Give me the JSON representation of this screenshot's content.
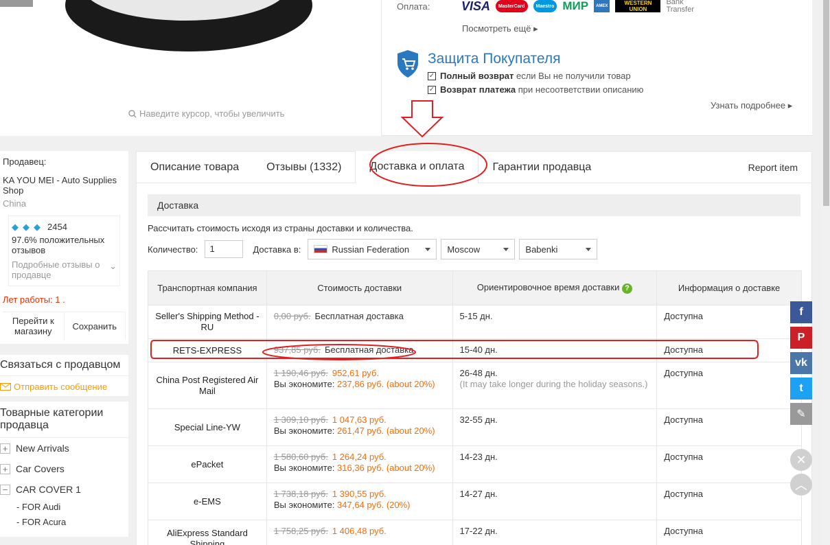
{
  "top": {
    "zoom_hint": "Наведите курсор, чтобы увеличить",
    "payment_label": "Оплата:",
    "payment_logos": [
      "VISA",
      "MasterCard",
      "Maestro",
      "МИР",
      "AMEX",
      "WESTERN UNION",
      "Bank Transfer"
    ],
    "see_more": "Посмотреть ещё",
    "protection_title": "Защита Покупателя",
    "protection_items": [
      {
        "bold": "Полный возврат",
        "text": "если Вы не получили товар"
      },
      {
        "bold": "Возврат платежа",
        "text": "при несоответствии описанию"
      }
    ],
    "learn_more": "Узнать подробнее"
  },
  "sidebar": {
    "seller_label": "Продавец:",
    "seller_name": "KA YOU MEI - Auto Supplies Shop",
    "seller_country": "China",
    "feedback_score": "2454",
    "positive_percent": "97.6%",
    "positive_text": "положительных отзывов",
    "detail_feedback": "Подробные отзывы о продавце",
    "years_label": "Лет работы:",
    "years_value": "1 .",
    "go_to_store": "Перейти к магазину",
    "save": "Сохранить",
    "contact_title": "Связаться с продавцом",
    "send_message": "Отправить сообщение",
    "categories_title": "Товарные категории продавца",
    "categories": [
      {
        "label": "New Arrivals",
        "toggle": "+"
      },
      {
        "label": "Car Covers",
        "toggle": "+"
      },
      {
        "label": "CAR COVER 1",
        "toggle": "−"
      }
    ],
    "subcategories": [
      "- FOR Audi",
      "- FOR Acura"
    ]
  },
  "tabs": {
    "items": [
      "Описание товара",
      "Отзывы (1332)",
      "Доставка и оплата",
      "Гарантии продавца"
    ],
    "active": "Доставка и оплата",
    "report": "Report item"
  },
  "delivery": {
    "section_title": "Доставка",
    "calc_text": "Рассчитать стоимость исходя из страны доставки и количества.",
    "qty_label": "Количество:",
    "qty_value": "1",
    "ship_to_label": "Доставка в:",
    "country": "Russian Federation",
    "city": "Moscow",
    "district": "Babenki",
    "headers": [
      "Транспортная компания",
      "Стоимость доставки",
      "Ориентировочное время доставки",
      "Информация о доставке"
    ],
    "rows": [
      {
        "company": "Seller's Shipping Method - RU",
        "old": "0,00 руб.",
        "new": "Бесплатная доставка",
        "free": true,
        "save_label": "",
        "save": "",
        "time": "5-15 дн.",
        "note": "",
        "info": "Доступна"
      },
      {
        "company": "RETS-EXPRESS",
        "old": "937,85 руб.",
        "new": "Бесплатная доставка",
        "free": true,
        "save_label": "",
        "save": "",
        "time": "15-40 дн.",
        "note": "",
        "info": "Доступна"
      },
      {
        "company": "China Post Registered Air Mail",
        "old": "1 190,46 руб.",
        "new": "952,61 руб.",
        "free": false,
        "save_label": "Вы экономите:",
        "save": "237,86 руб. (about 20%)",
        "time": "26-48 дн.",
        "note": "(It may take longer during the holiday seasons.)",
        "info": "Доступна"
      },
      {
        "company": "Special Line-YW",
        "old": "1 309,10 руб.",
        "new": "1 047,63 руб.",
        "free": false,
        "save_label": "Вы экономите:",
        "save": "261,47 руб. (about 20%)",
        "time": "32-55 дн.",
        "note": "",
        "info": "Доступна"
      },
      {
        "company": "ePacket",
        "old": "1 580,60 руб.",
        "new": "1 264,24 руб.",
        "free": false,
        "save_label": "Вы экономите:",
        "save": "316,36 руб. (about 20%)",
        "time": "14-23 дн.",
        "note": "",
        "info": "Доступна"
      },
      {
        "company": "e-EMS",
        "old": "1 738,18 руб.",
        "new": "1 390,55 руб.",
        "free": false,
        "save_label": "Вы экономите:",
        "save": "347,64 руб. (20%)",
        "time": "14-27 дн.",
        "note": "",
        "info": "Доступна"
      },
      {
        "company": "AliExpress Standard Shipping",
        "old": "1 758,25 руб.",
        "new": "1 406,48 руб.",
        "free": false,
        "save_label": "",
        "save": "",
        "time": "17-22 дн.",
        "note": "",
        "info": "Доступна"
      }
    ]
  },
  "social": [
    {
      "icon": "facebook-icon",
      "glyph": "f",
      "color": "#3b5998"
    },
    {
      "icon": "pinterest-icon",
      "glyph": "P",
      "color": "#cb2027"
    },
    {
      "icon": "vk-icon",
      "glyph": "vk",
      "color": "#4a76a8"
    },
    {
      "icon": "twitter-icon",
      "glyph": "t",
      "color": "#1da1f2"
    },
    {
      "icon": "edit-icon",
      "glyph": "✎",
      "color": "#999999"
    }
  ],
  "colors": {
    "accent": "#ff6a00",
    "annotation": "#e02020",
    "link_blue": "#2a79c0"
  }
}
